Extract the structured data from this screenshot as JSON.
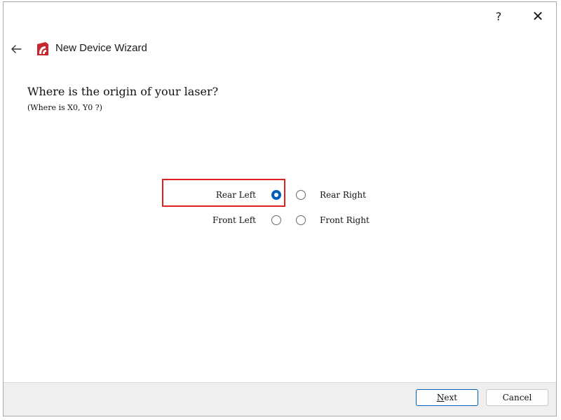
{
  "titlebar": {
    "help_label": "?",
    "close_label": "✕"
  },
  "header": {
    "back_icon": "back-arrow-icon",
    "logo_icon": "app-logo",
    "title": "New Device Wizard"
  },
  "question": {
    "text": "Where is the origin of your laser?",
    "hint": "(Where is X0, Y0 ?)"
  },
  "options": [
    {
      "label": "Rear Left",
      "selected": true
    },
    {
      "label": "Rear Right",
      "selected": false
    },
    {
      "label": "Front Left",
      "selected": false
    },
    {
      "label": "Front Right",
      "selected": false
    }
  ],
  "footer": {
    "next_mnemonic": "N",
    "next_rest": "ext",
    "cancel_label": "Cancel"
  },
  "colors": {
    "accent": "#005fb8",
    "highlight": "#e0201b",
    "logo": "#c8262e"
  }
}
